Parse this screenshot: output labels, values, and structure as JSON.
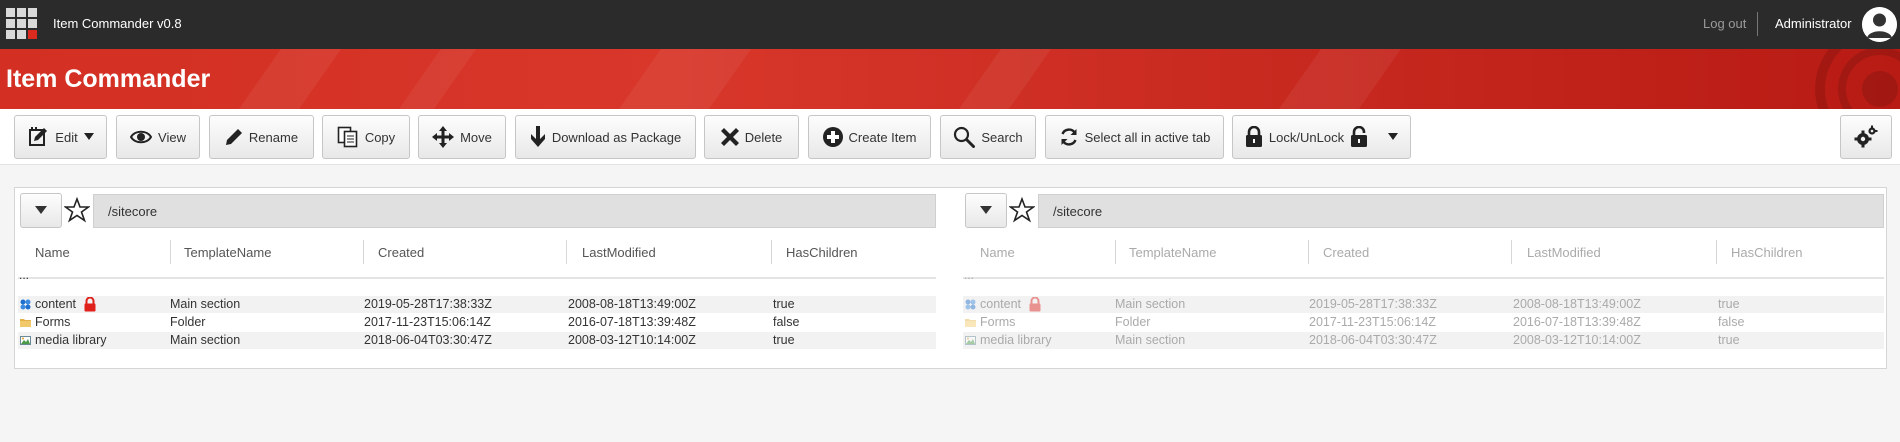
{
  "topbar": {
    "app_title": "Item Commander v0.8",
    "logout_label": "Log out",
    "user_name": "Administrator"
  },
  "header": {
    "title": "Item Commander"
  },
  "toolbar": {
    "edit": "Edit",
    "view": "View",
    "rename": "Rename",
    "copy": "Copy",
    "move": "Move",
    "download": "Download as Package",
    "delete": "Delete",
    "create": "Create Item",
    "search": "Search",
    "select_all": "Select all in active tab",
    "lock": "Lock/UnLock"
  },
  "panes": {
    "left": {
      "path": "/sitecore",
      "columns": [
        "Name",
        "TemplateName",
        "Created",
        "LastModified",
        "HasChildren"
      ],
      "parent": "...",
      "rows": [
        {
          "name": "content",
          "template": "Main section",
          "created": "2019-05-28T17:38:33Z",
          "modified": "2008-08-18T13:49:00Z",
          "children": "true",
          "icon": "content-icon",
          "locked": true
        },
        {
          "name": "Forms",
          "template": "Folder",
          "created": "2017-11-23T15:06:14Z",
          "modified": "2016-07-18T13:39:48Z",
          "children": "false",
          "icon": "folder-icon",
          "locked": false
        },
        {
          "name": "media library",
          "template": "Main section",
          "created": "2018-06-04T03:30:47Z",
          "modified": "2008-03-12T10:14:00Z",
          "children": "true",
          "icon": "media-library-icon",
          "locked": false
        }
      ]
    },
    "right": {
      "path": "/sitecore",
      "columns": [
        "Name",
        "TemplateName",
        "Created",
        "LastModified",
        "HasChildren"
      ],
      "parent": "...",
      "rows": [
        {
          "name": "content",
          "template": "Main section",
          "created": "2019-05-28T17:38:33Z",
          "modified": "2008-08-18T13:49:00Z",
          "children": "true",
          "icon": "content-icon",
          "locked": true
        },
        {
          "name": "Forms",
          "template": "Folder",
          "created": "2017-11-23T15:06:14Z",
          "modified": "2016-07-18T13:39:48Z",
          "children": "false",
          "icon": "folder-icon",
          "locked": false
        },
        {
          "name": "media library",
          "template": "Main section",
          "created": "2018-06-04T03:30:47Z",
          "modified": "2008-03-12T10:14:00Z",
          "children": "true",
          "icon": "media-library-icon",
          "locked": false
        }
      ]
    }
  },
  "colors": {
    "topbar": "#2b2b2b",
    "brand_red": "#d32f23",
    "lock_red": "#e0211b"
  }
}
